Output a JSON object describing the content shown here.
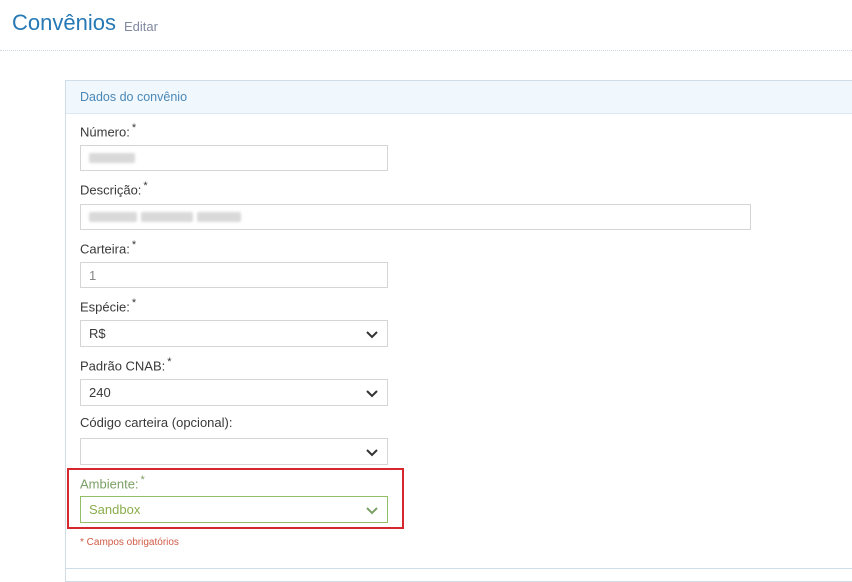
{
  "header": {
    "title": "Convênios",
    "subtitle": "Editar"
  },
  "form": {
    "section_title": "Dados do convênio",
    "numero": {
      "label": "Número:",
      "required": "*",
      "value": ""
    },
    "descricao": {
      "label": "Descrição:",
      "required": "*",
      "value": ""
    },
    "carteira": {
      "label": "Carteira:",
      "required": "*",
      "value": "1"
    },
    "especie": {
      "label": "Espécie:",
      "required": "*",
      "value": "R$"
    },
    "padrao_cnab": {
      "label": "Padrão CNAB:",
      "required": "*",
      "value": "240"
    },
    "codigo_carteira": {
      "label": "Código carteira (opcional):",
      "value": ""
    },
    "ambiente": {
      "label": "Ambiente:",
      "required": "*",
      "value": "Sandbox"
    },
    "required_note": "* Campos obrigatórios"
  },
  "colors": {
    "title": "#2679b5",
    "highlight": "#d6272f",
    "success": "#7ba065",
    "error_text": "#d15b47"
  },
  "icons": {
    "select_arrow": "chevron-down-icon"
  }
}
